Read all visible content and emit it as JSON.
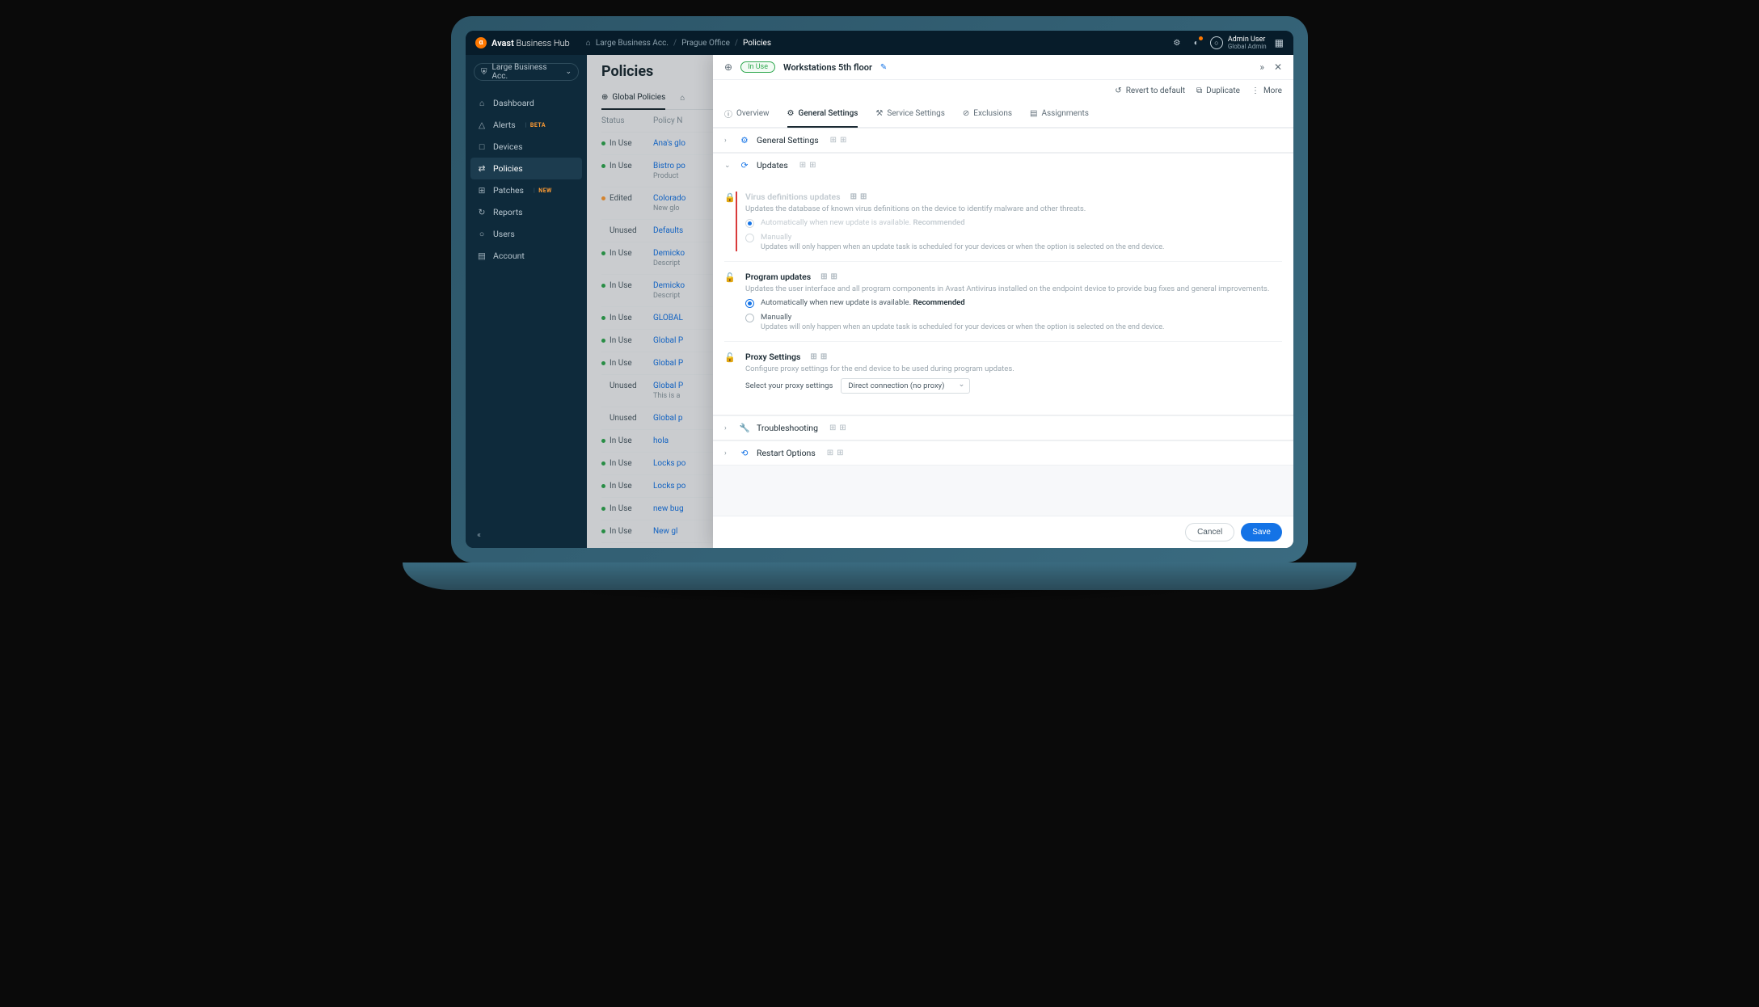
{
  "brand": {
    "name_bold": "Avast",
    "name_light": " Business Hub"
  },
  "breadcrumbs": {
    "home": "⌂",
    "acc": "Large Business Acc.",
    "site": "Prague Office",
    "page": "Policies"
  },
  "user": {
    "name": "Admin User",
    "role": "Global Admin"
  },
  "account_picker": "Large Business Acc.",
  "sidebar": {
    "items": [
      {
        "icon": "⌂",
        "label": "Dashboard"
      },
      {
        "icon": "△",
        "label": "Alerts",
        "badge": "BETA"
      },
      {
        "icon": "□",
        "label": "Devices"
      },
      {
        "icon": "⇄",
        "label": "Policies",
        "active": true
      },
      {
        "icon": "⊞",
        "label": "Patches",
        "badge": "NEW"
      },
      {
        "icon": "↻",
        "label": "Reports"
      },
      {
        "icon": "○",
        "label": "Users"
      },
      {
        "icon": "▤",
        "label": "Account"
      }
    ]
  },
  "page": {
    "title": "Policies"
  },
  "page_tabs": {
    "global": "Global Policies"
  },
  "table": {
    "h_status": "Status",
    "h_name": "Policy N",
    "rows": [
      {
        "status": "In Use",
        "dot": "green",
        "name": "Ana's glo"
      },
      {
        "status": "In Use",
        "dot": "green",
        "name": "Bistro po",
        "sub": "Product"
      },
      {
        "status": "Edited",
        "dot": "orange",
        "name": "Colorado",
        "sub": "New glo"
      },
      {
        "status": "Unused",
        "dot": "none",
        "name": "Defaults"
      },
      {
        "status": "In Use",
        "dot": "green",
        "name": "Demicko",
        "sub": "Descript"
      },
      {
        "status": "In Use",
        "dot": "green",
        "name": "Demicko",
        "sub": "Descript"
      },
      {
        "status": "In Use",
        "dot": "green",
        "name": "GLOBAL"
      },
      {
        "status": "In Use",
        "dot": "green",
        "name": "Global P"
      },
      {
        "status": "In Use",
        "dot": "green",
        "name": "Global P"
      },
      {
        "status": "Unused",
        "dot": "none",
        "name": "Global P",
        "sub": "This is a"
      },
      {
        "status": "Unused",
        "dot": "none",
        "name": "Global p"
      },
      {
        "status": "In Use",
        "dot": "green",
        "name": "hola"
      },
      {
        "status": "In Use",
        "dot": "green",
        "name": "Locks po"
      },
      {
        "status": "In Use",
        "dot": "green",
        "name": "Locks po"
      },
      {
        "status": "In Use",
        "dot": "green",
        "name": "new bug"
      },
      {
        "status": "In Use",
        "dot": "green",
        "name": "New gl"
      }
    ]
  },
  "drawer": {
    "chip": "In Use",
    "title": "Workstations 5th floor",
    "toolbar": {
      "revert": "Revert to default",
      "duplicate": "Duplicate",
      "more": "More"
    },
    "tabs": {
      "overview": "Overview",
      "general": "General Settings",
      "service": "Service Settings",
      "exclusions": "Exclusions",
      "assignments": "Assignments"
    },
    "sections": {
      "general": "General Settings",
      "updates": "Updates",
      "troubleshooting": "Troubleshooting",
      "restart": "Restart Options"
    },
    "updates": {
      "virus": {
        "title": "Virus definitions updates",
        "desc": "Updates the database of known virus definitions on the device to identify malware and other threats.",
        "opt_auto": "Automatically when new update is available.",
        "rec": "Recommended",
        "opt_manual": "Manually",
        "manual_sub": "Updates will only happen when an update task is scheduled for your devices or when the option is selected on the end device."
      },
      "program": {
        "title": "Program updates",
        "desc": "Updates the user interface and all program components in Avast Antivirus installed on the endpoint device to provide bug fixes and general improvements.",
        "opt_auto": "Automatically when new update is available.",
        "rec": "Recommended",
        "opt_manual": "Manually",
        "manual_sub": "Updates will only happen when an update task is scheduled for your devices or when the option is selected on the end device."
      },
      "proxy": {
        "title": "Proxy Settings",
        "desc": "Configure proxy settings for the end device to be used during program updates.",
        "label": "Select your proxy settings",
        "value": "Direct connection (no proxy)"
      }
    },
    "buttons": {
      "cancel": "Cancel",
      "save": "Save"
    }
  }
}
